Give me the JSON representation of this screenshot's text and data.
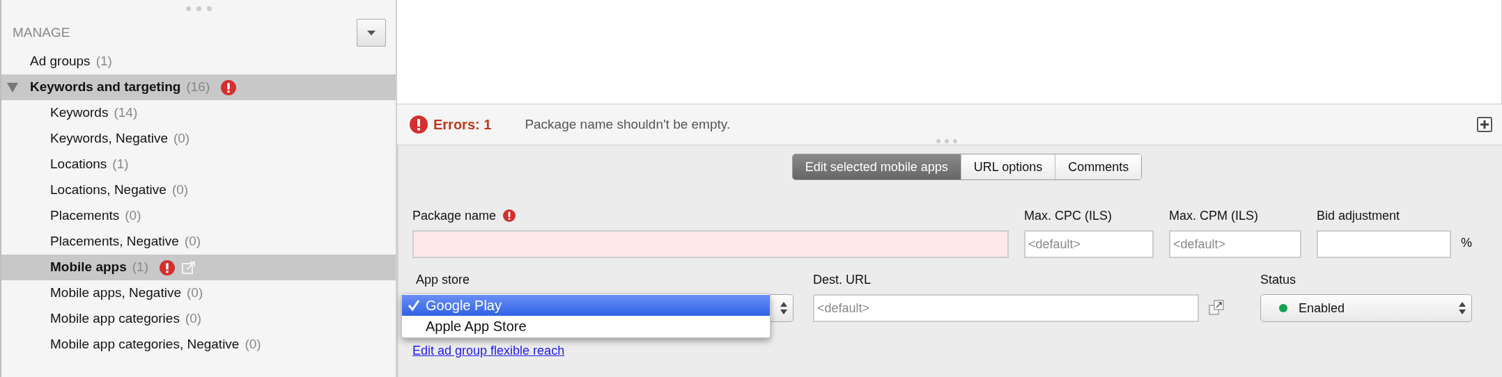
{
  "sidebar": {
    "title": "MANAGE",
    "items": [
      {
        "label": "Ad groups",
        "count": "(1)",
        "selected": false,
        "error": false,
        "popout": false
      },
      {
        "label": "Keywords and targeting",
        "count": "(16)",
        "selected": true,
        "expanded": true,
        "error": true,
        "popout": false,
        "children": [
          {
            "label": "Keywords",
            "count": "(14)",
            "selected": false,
            "error": false,
            "popout": false
          },
          {
            "label": "Keywords, Negative",
            "count": "(0)",
            "selected": false,
            "error": false,
            "popout": false
          },
          {
            "label": "Locations",
            "count": "(1)",
            "selected": false,
            "error": false,
            "popout": false
          },
          {
            "label": "Locations, Negative",
            "count": "(0)",
            "selected": false,
            "error": false,
            "popout": false
          },
          {
            "label": "Placements",
            "count": "(0)",
            "selected": false,
            "error": false,
            "popout": false
          },
          {
            "label": "Placements, Negative",
            "count": "(0)",
            "selected": false,
            "error": false,
            "popout": false
          },
          {
            "label": "Mobile apps",
            "count": "(1)",
            "selected": true,
            "error": true,
            "popout": true
          },
          {
            "label": "Mobile apps, Negative",
            "count": "(0)",
            "selected": false,
            "error": false,
            "popout": false
          },
          {
            "label": "Mobile app categories",
            "count": "(0)",
            "selected": false,
            "error": false,
            "popout": false
          },
          {
            "label": "Mobile app categories, Negative",
            "count": "(0)",
            "selected": false,
            "error": false,
            "popout": false
          }
        ]
      }
    ]
  },
  "errors": {
    "label": "Errors: 1",
    "message": "Package name shouldn't be empty."
  },
  "tabs": [
    {
      "label": "Edit selected mobile apps",
      "selected": true
    },
    {
      "label": "URL options",
      "selected": false
    },
    {
      "label": "Comments",
      "selected": false
    }
  ],
  "form": {
    "package_name": {
      "label": "Package name",
      "error": true
    },
    "max_cpc": {
      "label": "Max. CPC (ILS)",
      "placeholder": "<default>"
    },
    "max_cpm": {
      "label": "Max. CPM (ILS)",
      "placeholder": "<default>"
    },
    "bid_adjustment": {
      "label": "Bid adjustment",
      "unit": "%"
    },
    "app_store": {
      "label": "App store",
      "open": true,
      "options": [
        {
          "label": "Google Play",
          "selected": true
        },
        {
          "label": "Apple App Store",
          "selected": false
        }
      ]
    },
    "dest_url": {
      "label": "Dest. URL",
      "placeholder": "<default>"
    },
    "status": {
      "label": "Status",
      "value": "Enabled",
      "color": "#12a150"
    },
    "link": "Edit ad group flexible reach"
  }
}
